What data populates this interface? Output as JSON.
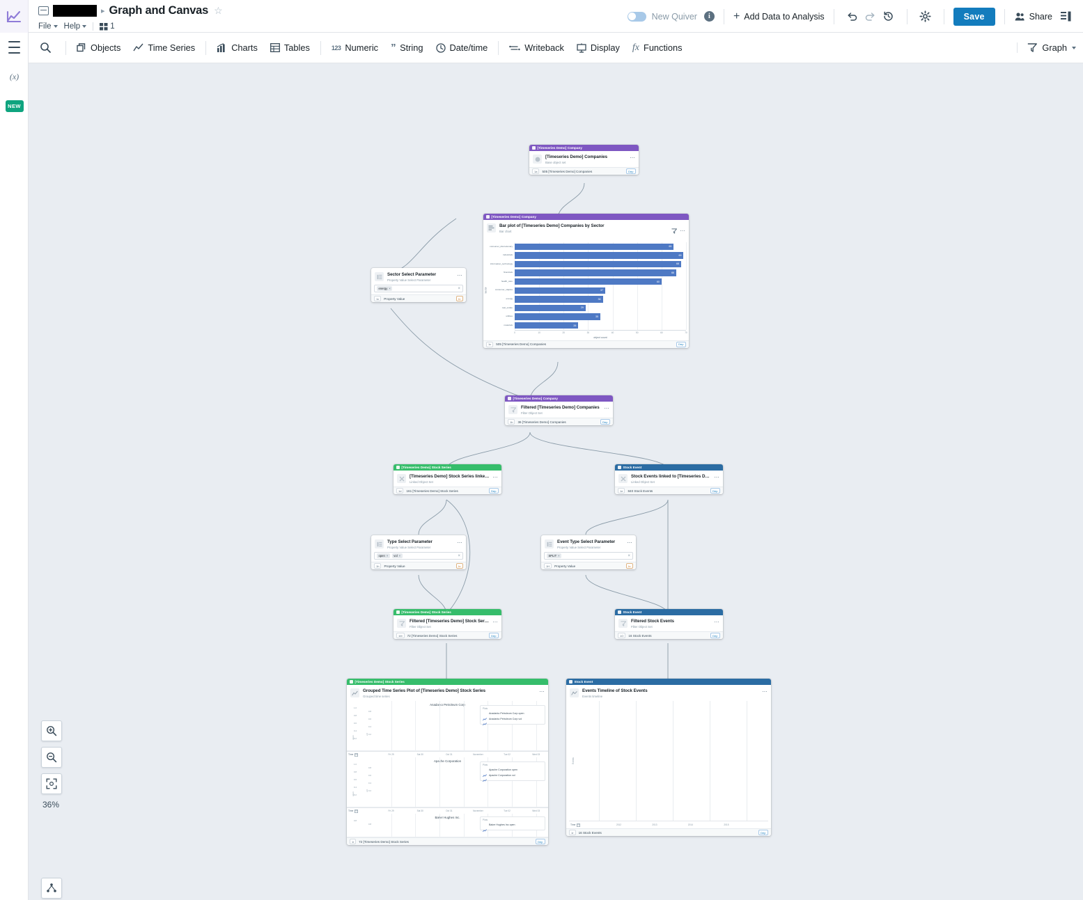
{
  "titlebar": {
    "breadcrumb_redacted": true,
    "doc_title": "Graph and Canvas",
    "star_icon": "star-outline-icon",
    "menus": [
      "File",
      "Help"
    ],
    "version_icon": "grid-icon",
    "version_number": "1",
    "toggle_label": "New Quiver",
    "info_icon": "info-icon",
    "add_data_label": "Add Data to Analysis",
    "undo_icon": "undo-icon",
    "redo_icon": "redo-icon",
    "history_icon": "history-icon",
    "settings_icon": "gear-icon",
    "save_label": "Save",
    "share_label": "Share",
    "panel_icon": "side-panel-icon",
    "accent_color": "#137cbd"
  },
  "toolbar": {
    "search_icon": "search-icon",
    "items": [
      {
        "label": "Objects",
        "icon": "objects-icon"
      },
      {
        "label": "Time Series",
        "icon": "timeseries-icon"
      },
      {
        "label": "Charts",
        "icon": "charts-icon"
      },
      {
        "label": "Tables",
        "icon": "tables-icon"
      },
      {
        "label": "Numeric",
        "icon": "123-icon"
      },
      {
        "label": "String",
        "icon": "quote-icon"
      },
      {
        "label": "Date/time",
        "icon": "clock-icon"
      },
      {
        "label": "Writeback",
        "icon": "writeback-icon"
      },
      {
        "label": "Display",
        "icon": "display-icon"
      },
      {
        "label": "Functions",
        "icon": "fx-icon"
      }
    ],
    "mode_label": "Graph",
    "mode_icon": "filter-icon"
  },
  "rail": {
    "menu_icon": "hamburger-icon",
    "variables_icon": "variables-icon",
    "new_badge": "NEW"
  },
  "canvas": {
    "zoom_in_icon": "zoom-in-icon",
    "zoom_out_icon": "zoom-out-icon",
    "fit_icon": "fit-to-screen-icon",
    "zoom_level": "36%",
    "layout_icon": "auto-layout-icon"
  },
  "nodes": {
    "companies": {
      "header": "[Timeseries Demo] Company",
      "title": "[Timeseries Demo] Companies",
      "subtitle": "Base object set",
      "foot_chip": "1a",
      "foot_text": "505 [Timeseries Demo] Companies",
      "foot_badge": "Dep",
      "color": "#7e57c2"
    },
    "bar_plot": {
      "header": "[Timeseries Demo] Company",
      "title": "Bar plot of [Timeseries Demo] Companies by Sector",
      "subtitle": "Bar chart",
      "filter_icon": "filter-icon",
      "foot_chip": "1c",
      "foot_text": "505 [Timeseries Demo] Companies",
      "foot_badge": "Dep",
      "color": "#7e57c2"
    },
    "sector_param": {
      "title": "Sector Select Parameter",
      "subtitle": "Property Value Select Parameter",
      "tags": [
        "energy"
      ],
      "clear_icon": "clear-icon",
      "foot_chip": "1c",
      "foot_text": "Property Value",
      "foot_badge": "In"
    },
    "filtered_companies": {
      "header": "[Timeseries Demo] Company",
      "title": "Filtered [Timeseries Demo] Companies",
      "subtitle": "Filter Object Set",
      "foot_chip": "1b",
      "foot_text": "36 [Timeseries Demo] Companies",
      "foot_badge": "Dep",
      "color": "#7e57c2"
    },
    "stock_series_linked": {
      "header": "[Timeseries Demo] Stock Series",
      "title": "[Timeseries Demo] Stock Series linked to [T...",
      "subtitle": "Linked Object Set",
      "foot_chip": "1d",
      "foot_text": "161 [Timeseries Demo] Stock Series",
      "foot_badge": "Dep",
      "color": "#36bd6b"
    },
    "stock_events_linked": {
      "header": "Stock Event",
      "title": "Stock Events linked to [Timeseries Demo] C...",
      "subtitle": "Linked Object Set",
      "foot_chip": "1e",
      "foot_text": "840 Stock Events",
      "foot_badge": "Dep",
      "color": "#2b6ca3"
    },
    "type_param": {
      "title": "Type Select Parameter",
      "subtitle": "Property Value Select Parameter",
      "tags": [
        "open",
        "vol"
      ],
      "clear_icon": "clear-icon",
      "foot_chip": "1h",
      "foot_text": "Property Value",
      "foot_badge": "In"
    },
    "event_type_param": {
      "title": "Event Type Select Parameter",
      "subtitle": "Property Value Select Parameter",
      "tags": [
        "SPLIT"
      ],
      "clear_icon": "clear-icon",
      "foot_chip": "1H",
      "foot_text": "Property Value",
      "foot_badge": "In"
    },
    "filtered_stock_series": {
      "header": "[Timeseries Demo] Stock Series",
      "title": "Filtered [Timeseries Demo] Stock Series",
      "subtitle": "Filter Object Set",
      "foot_chip": "1M",
      "foot_text": "72 [Timeseries Demo] Stock Series",
      "foot_badge": "Dep",
      "color": "#36bd6b"
    },
    "filtered_stock_events": {
      "header": "Stock Event",
      "title": "Filtered Stock Events",
      "subtitle": "Filter Object Set",
      "foot_chip": "1O",
      "foot_text": "16 Stock Events",
      "foot_badge": "Dep",
      "color": "#2b6ca3"
    },
    "grouped_ts": {
      "header": "[Timeseries Demo] Stock Series",
      "title": "Grouped Time Series Plot of [Timeseries Demo] Stock Series",
      "subtitle": "Grouped time series",
      "foot_chip": "1i",
      "foot_text": "72 [Timeseries Demo] Stock Series",
      "foot_badge": "Dep",
      "color": "#36bd6b"
    },
    "events_timeline": {
      "header": "Stock Event",
      "title": "Events Timeline of Stock Events",
      "subtitle": "Events timeline",
      "foot_chip": "1r",
      "foot_text": "16 Stock Events",
      "foot_badge": "Dep",
      "color": "#2b6ca3"
    }
  },
  "chart_data": [
    {
      "type": "bar",
      "title": "Bar plot of [Timeseries Demo] Companies by Sector",
      "orientation": "horizontal",
      "categories": [
        "consumer_discretionary",
        "industrials",
        "information_technology",
        "financials",
        "health_care",
        "consumer_staples",
        "energy",
        "real_estate",
        "utilities",
        "materials"
      ],
      "values": [
        65,
        69,
        68,
        66,
        60,
        37,
        36,
        29,
        35,
        26
      ],
      "xlabel": "object count",
      "ylabel": "Sector",
      "xlim": [
        0,
        70
      ],
      "xticks": [
        0,
        10,
        20,
        30,
        40,
        50,
        60,
        70
      ],
      "bar_color": "#4e79c4",
      "grid": true
    },
    {
      "type": "line",
      "title": "Grouped Time Series Plot of [Timeseries Demo] Stock Series",
      "panels": [
        {
          "title": "Anadarko Petroleum Corp",
          "legend_header": "Plots",
          "series": [
            "Anadarko Petroleum Corp open",
            "Anadarko Petroleum Corp vol"
          ],
          "yticks": [
            "0.8",
            "0.6",
            "0.4",
            "0.2"
          ],
          "yticks2": [
            "1.0",
            "0.8",
            "0.6",
            "0.4",
            "0.2"
          ],
          "ylabel": "open",
          "ylabel2": "vol",
          "xticks": [
            "Fri 29",
            "Sat 30",
            "Oct 31",
            "November",
            "Tue 02",
            "Wed 03"
          ]
        },
        {
          "title": "Apache Corporation",
          "legend_header": "Plots",
          "series": [
            "Apache Corporation open",
            "Apache Corporation vol"
          ],
          "yticks": [
            "0.8",
            "0.6",
            "0.4",
            "0.2"
          ],
          "yticks2": [
            "1.0",
            "0.8",
            "0.6",
            "0.4",
            "0.2"
          ],
          "ylabel": "open",
          "ylabel2": "vol",
          "xticks": [
            "Fri 29",
            "Sat 30",
            "Oct 31",
            "November",
            "Tue 02",
            "Wed 03"
          ]
        },
        {
          "title": "Baker Hughes Inc.",
          "legend_header": "Plots",
          "series": [
            "Baker Hughes Inc open"
          ],
          "yticks": [
            "0.8"
          ],
          "yticks2": [
            "0.8"
          ],
          "ylabel": "open",
          "ylabel2": "vol",
          "xticks": []
        }
      ],
      "time_label": "Time",
      "xlabel": "",
      "ylabel": ""
    },
    {
      "type": "scatter",
      "title": "Events Timeline of Stock Events",
      "xticks": [
        "2012",
        "2013",
        "2014",
        "2015"
      ],
      "ylabel": "Events",
      "xlabel": "",
      "time_label": "Time",
      "points": []
    }
  ]
}
